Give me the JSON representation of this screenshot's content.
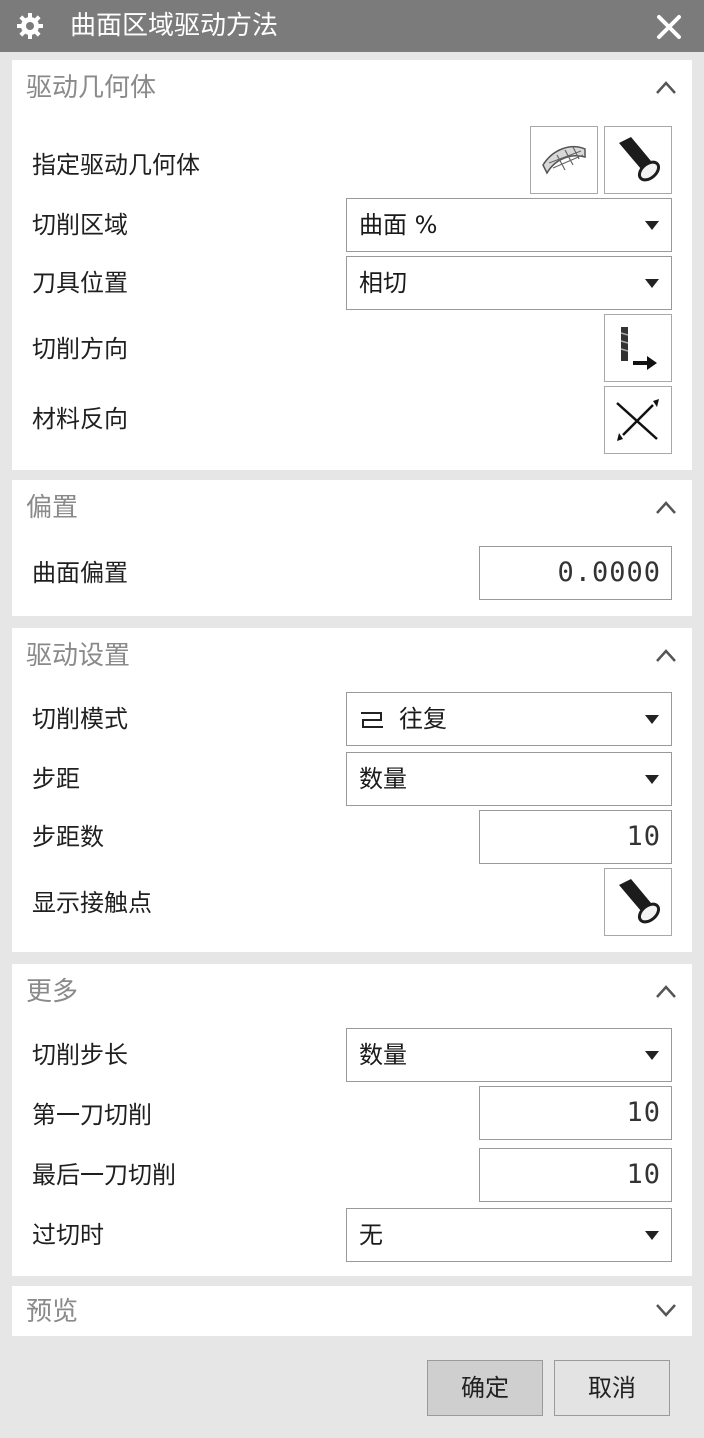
{
  "window": {
    "title": "曲面区域驱动方法"
  },
  "drive_geometry": {
    "title": "驱动几何体",
    "specify_label": "指定驱动几何体",
    "cut_area_label": "切削区域",
    "cut_area_value": "曲面 %",
    "tool_position_label": "刀具位置",
    "tool_position_value": "相切",
    "cut_direction_label": "切削方向",
    "material_reverse_label": "材料反向"
  },
  "offset": {
    "title": "偏置",
    "surface_offset_label": "曲面偏置",
    "surface_offset_value": "0.0000"
  },
  "drive_settings": {
    "title": "驱动设置",
    "cut_pattern_label": "切削模式",
    "cut_pattern_value": "往复",
    "stepover_label": "步距",
    "stepover_value": "数量",
    "stepover_count_label": "步距数",
    "stepover_count_value": "10",
    "display_contact_label": "显示接触点"
  },
  "more": {
    "title": "更多",
    "cut_step_label": "切削步长",
    "cut_step_value": "数量",
    "first_cut_label": "第一刀切削",
    "first_cut_value": "10",
    "last_cut_label": "最后一刀切削",
    "last_cut_value": "10",
    "overcut_label": "过切时",
    "overcut_value": "无"
  },
  "preview": {
    "title": "预览"
  },
  "footer": {
    "ok_label": "确定",
    "cancel_label": "取消"
  },
  "icons": {
    "title": "gear-icon",
    "close": "close-icon",
    "collapse": "chevron-up-icon",
    "expand": "chevron-down-icon",
    "surface": "surface-geometry-icon",
    "display": "flashlight-icon",
    "cut_direction": "cut-direction-icon",
    "reverse": "reverse-material-icon",
    "zigzag": "zigzag-pattern-icon"
  },
  "colors": {
    "titlebar": "#7b7b7b",
    "panel": "#ffffff",
    "background": "#e6e6e6",
    "section_title": "#8a8a8a"
  }
}
